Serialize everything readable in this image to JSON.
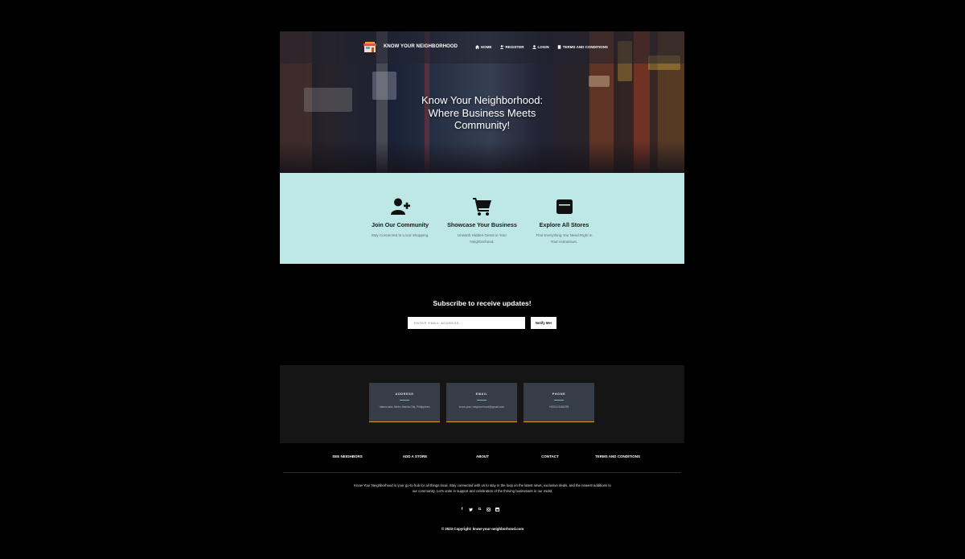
{
  "nav": {
    "brand": "KNOW YOUR NEIGHBORHOOD",
    "links": [
      "HOME",
      "REGISTER",
      "LOGIN",
      "TERMS AND CONDITIONS"
    ]
  },
  "hero": {
    "title_line1": "Know Your Neighborhood:",
    "title_line2": "Where Business Meets",
    "title_line3": "Community!"
  },
  "features": [
    {
      "icon": "user-plus-icon",
      "title": "Join Our Community",
      "desc_line1": "Stay Connected to Local Shopping.",
      "desc_line2": ""
    },
    {
      "icon": "shopping-cart-icon",
      "title": "Showcase Your Business",
      "desc_line1": "Unearth Hidden Gems in Your",
      "desc_line2": "Neighborhood."
    },
    {
      "icon": "window-icon",
      "title": "Explore All Stores",
      "desc_line1": "Find Everything You Need Right in",
      "desc_line2": "Your Hometown."
    }
  ],
  "subscribe": {
    "title": "Subscribe to receive updates!",
    "placeholder": "ENTER EMAIL ADDRESS...",
    "button": "Notify Me!"
  },
  "contact": [
    {
      "label": "ADDRESS",
      "value": "Valenzuela, Metro Manila City, Philippines"
    },
    {
      "label": "EMAIL",
      "value": "know-your-neighborhood@gmail.com"
    },
    {
      "label": "PHONE",
      "value": "+639123456789"
    }
  ],
  "footer": {
    "links": [
      "SEE NEIGHBORS",
      "ADD A STORE",
      "ABOUT",
      "CONTACT",
      "TERMS AND CONDITIONS"
    ],
    "about_line1": "Know Your Neighborhood is your go-to hub for all things local. Stay connected with us to stay in the loop on the latest news, exclusive deals, and the newest additions to",
    "about_line2": "our community. Let's unite in support and celebration of the thriving businesses in our midst.",
    "socials": [
      "f",
      "t",
      "G",
      "ig",
      "in"
    ],
    "copyright": "© 2023 Copyright: know-your-neighborhood.com"
  }
}
